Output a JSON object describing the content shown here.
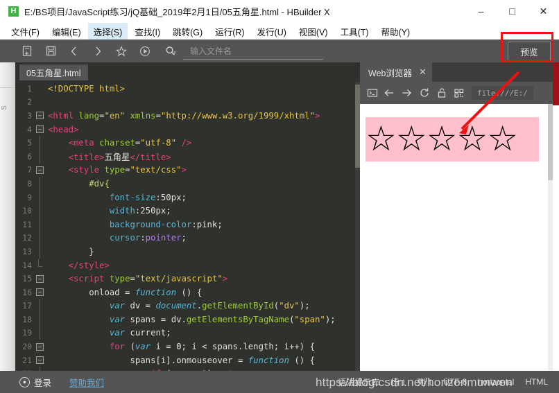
{
  "window": {
    "logo_letter": "H",
    "title": "E:/BS项目/JavaScript练习/jQ基础_2019年2月1日/05五角星.html - HBuilder X",
    "minimize": "–",
    "maximize": "□",
    "close": "✕"
  },
  "menubar": {
    "items": [
      {
        "label": "文件(F)",
        "active": false
      },
      {
        "label": "编辑(E)",
        "active": false
      },
      {
        "label": "选择(S)",
        "active": true
      },
      {
        "label": "查找(I)",
        "active": false
      },
      {
        "label": "跳转(G)",
        "active": false
      },
      {
        "label": "运行(R)",
        "active": false
      },
      {
        "label": "发行(U)",
        "active": false
      },
      {
        "label": "视图(V)",
        "active": false
      },
      {
        "label": "工具(T)",
        "active": false
      },
      {
        "label": "帮助(Y)",
        "active": false
      }
    ]
  },
  "toolbar": {
    "icons": [
      {
        "name": "new-file-icon",
        "glyph": "▤"
      },
      {
        "name": "save-icon",
        "glyph": "▣"
      },
      {
        "name": "back-icon",
        "glyph": "‹"
      },
      {
        "name": "forward-icon",
        "glyph": "›"
      },
      {
        "name": "favorite-star-icon",
        "glyph": "☆"
      },
      {
        "name": "run-icon",
        "glyph": "▷"
      }
    ],
    "search_icon": "Q",
    "search_icon_sub": "F",
    "filename_placeholder": "输入文件名",
    "preview_button": "预览"
  },
  "editor": {
    "tab_label": "05五角星.html",
    "lines": [
      {
        "no": "1",
        "fold": "",
        "indent": 0,
        "tokens": [
          {
            "c": "t-doctype",
            "t": "<!DOCTYPE html>"
          }
        ]
      },
      {
        "no": "2",
        "fold": "",
        "indent": 0,
        "tokens": []
      },
      {
        "no": "3",
        "fold": "-",
        "indent": 0,
        "tokens": [
          {
            "c": "t-tag",
            "t": "<html "
          },
          {
            "c": "t-attr",
            "t": "lang"
          },
          {
            "c": "t-white",
            "t": "="
          },
          {
            "c": "t-str",
            "t": "\"en\""
          },
          {
            "c": "t-white",
            "t": " "
          },
          {
            "c": "t-attr",
            "t": "xmlns"
          },
          {
            "c": "t-white",
            "t": "="
          },
          {
            "c": "t-str",
            "t": "\"http://www.w3.org/1999/xhtml\""
          },
          {
            "c": "t-tag",
            "t": ">"
          }
        ]
      },
      {
        "no": "4",
        "fold": "-",
        "indent": 0,
        "tokens": [
          {
            "c": "t-tag",
            "t": "<head>"
          }
        ]
      },
      {
        "no": "5",
        "fold": "|",
        "indent": 1,
        "tokens": [
          {
            "c": "t-tag",
            "t": "<meta "
          },
          {
            "c": "t-attr",
            "t": "charset"
          },
          {
            "c": "t-white",
            "t": "="
          },
          {
            "c": "t-str",
            "t": "\"utf-8\""
          },
          {
            "c": "t-tag",
            "t": " />"
          }
        ]
      },
      {
        "no": "6",
        "fold": "|",
        "indent": 1,
        "tokens": [
          {
            "c": "t-tag",
            "t": "<title>"
          },
          {
            "c": "t-white",
            "t": "五角星"
          },
          {
            "c": "t-tag",
            "t": "</title>"
          }
        ]
      },
      {
        "no": "7",
        "fold": "-",
        "indent": 1,
        "tokens": [
          {
            "c": "t-tag",
            "t": "<style "
          },
          {
            "c": "t-attr",
            "t": "type"
          },
          {
            "c": "t-white",
            "t": "="
          },
          {
            "c": "t-str",
            "t": "\"text/css\""
          },
          {
            "c": "t-tag",
            "t": ">"
          }
        ]
      },
      {
        "no": "8",
        "fold": "|",
        "indent": 2,
        "tokens": [
          {
            "c": "t-sel",
            "t": "#dv{"
          }
        ]
      },
      {
        "no": "9",
        "fold": "|",
        "indent": 3,
        "tokens": [
          {
            "c": "t-css-prop",
            "t": "font-size"
          },
          {
            "c": "t-white",
            "t": ":50px;"
          }
        ]
      },
      {
        "no": "10",
        "fold": "|",
        "indent": 3,
        "tokens": [
          {
            "c": "t-css-prop",
            "t": "width"
          },
          {
            "c": "t-white",
            "t": ":250px;"
          }
        ]
      },
      {
        "no": "11",
        "fold": "|",
        "indent": 3,
        "tokens": [
          {
            "c": "t-css-prop",
            "t": "background-color"
          },
          {
            "c": "t-white",
            "t": ":pink;"
          }
        ]
      },
      {
        "no": "12",
        "fold": "|",
        "indent": 3,
        "tokens": [
          {
            "c": "t-css-prop",
            "t": "cursor"
          },
          {
            "c": "t-white",
            "t": ":"
          },
          {
            "c": "t-purple",
            "t": "pointer"
          },
          {
            "c": "t-white",
            "t": ";"
          }
        ]
      },
      {
        "no": "13",
        "fold": "|",
        "indent": 2,
        "tokens": [
          {
            "c": "t-white",
            "t": "}"
          }
        ]
      },
      {
        "no": "14",
        "fold": "└",
        "indent": 1,
        "tokens": [
          {
            "c": "t-tag",
            "t": "</style>"
          }
        ]
      },
      {
        "no": "15",
        "fold": "-",
        "indent": 1,
        "tokens": [
          {
            "c": "t-tag",
            "t": "<script "
          },
          {
            "c": "t-attr",
            "t": "type"
          },
          {
            "c": "t-white",
            "t": "="
          },
          {
            "c": "t-str",
            "t": "\"text/javascript\""
          },
          {
            "c": "t-tag",
            "t": ">"
          }
        ]
      },
      {
        "no": "16",
        "fold": "-",
        "indent": 2,
        "tokens": [
          {
            "c": "t-white",
            "t": "onload = "
          },
          {
            "c": "t-kw2",
            "t": "function"
          },
          {
            "c": "t-white",
            "t": " () {"
          }
        ]
      },
      {
        "no": "17",
        "fold": "|",
        "indent": 3,
        "tokens": [
          {
            "c": "t-kw2",
            "t": "var"
          },
          {
            "c": "t-white",
            "t": " dv = "
          },
          {
            "c": "t-obj",
            "t": "document"
          },
          {
            "c": "t-white",
            "t": "."
          },
          {
            "c": "t-fn",
            "t": "getElementById"
          },
          {
            "c": "t-white",
            "t": "("
          },
          {
            "c": "t-str",
            "t": "\"dv\""
          },
          {
            "c": "t-white",
            "t": ");"
          }
        ]
      },
      {
        "no": "18",
        "fold": "|",
        "indent": 3,
        "tokens": [
          {
            "c": "t-kw2",
            "t": "var"
          },
          {
            "c": "t-white",
            "t": " spans = dv."
          },
          {
            "c": "t-fn",
            "t": "getElementsByTagName"
          },
          {
            "c": "t-white",
            "t": "("
          },
          {
            "c": "t-str",
            "t": "\"span\""
          },
          {
            "c": "t-white",
            "t": ");"
          }
        ]
      },
      {
        "no": "19",
        "fold": "|",
        "indent": 3,
        "tokens": [
          {
            "c": "t-kw2",
            "t": "var"
          },
          {
            "c": "t-white",
            "t": " current;"
          }
        ]
      },
      {
        "no": "20",
        "fold": "-",
        "indent": 3,
        "tokens": [
          {
            "c": "t-kw",
            "t": "for"
          },
          {
            "c": "t-white",
            "t": " ("
          },
          {
            "c": "t-kw2",
            "t": "var"
          },
          {
            "c": "t-white",
            "t": " i = "
          },
          {
            "c": "t-num",
            "t": "0"
          },
          {
            "c": "t-white",
            "t": "; i < spans.length; i++) {"
          }
        ]
      },
      {
        "no": "21",
        "fold": "-",
        "indent": 4,
        "tokens": [
          {
            "c": "t-white",
            "t": "spans[i].onmouseover = "
          },
          {
            "c": "t-kw2",
            "t": "function"
          },
          {
            "c": "t-white",
            "t": " () {"
          }
        ]
      },
      {
        "no": "22",
        "fold": "|",
        "indent": 5,
        "tokens": [
          {
            "c": "t-kw",
            "t": "if"
          },
          {
            "c": "t-white",
            "t": " (current) "
          },
          {
            "c": "t-kw",
            "t": "return"
          },
          {
            "c": "t-white",
            "t": ";"
          }
        ]
      }
    ]
  },
  "browser": {
    "tab_label": "Web浏览器",
    "tab_close": "✕",
    "toolbar_icons": [
      {
        "name": "console-icon",
        "glyph": "▣"
      },
      {
        "name": "back-arrow-icon",
        "glyph": "←"
      },
      {
        "name": "forward-arrow-icon",
        "glyph": "→"
      },
      {
        "name": "reload-icon",
        "glyph": "⟳"
      },
      {
        "name": "unlock-icon",
        "glyph": "🔓"
      },
      {
        "name": "qrcode-icon",
        "glyph": "▦"
      }
    ],
    "url": "file:///E:/",
    "page": {
      "stars": "☆☆☆☆☆",
      "background_color": "#ffc0cb"
    }
  },
  "statusbar": {
    "login_label": "登录",
    "sponsor_label": "赞助我们",
    "syntax_lib": "语法提示库",
    "segments": [
      "行:1",
      "列:1",
      "UTF-8",
      "horizontal",
      "HTML"
    ]
  },
  "watermark": {
    "text": "https://blog.csdn.net/horizonmunwen"
  },
  "colors": {
    "editor_bg": "#2f312c",
    "chrome_bg": "#545454",
    "accent_red": "#ee1111",
    "pink": "#ffc0cb",
    "link_blue": "#6fa8d0",
    "menu_active": "#d9ecf7"
  }
}
